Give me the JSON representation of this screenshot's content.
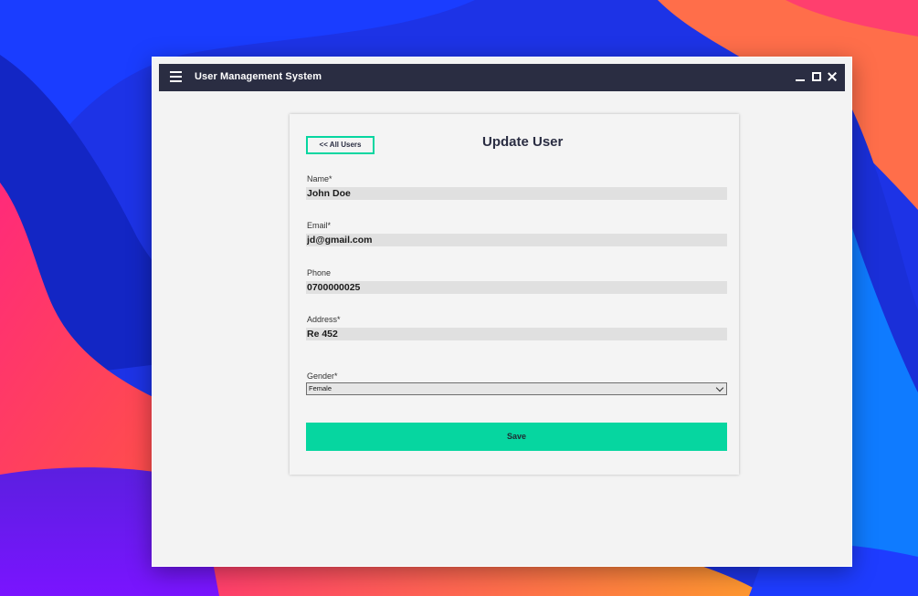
{
  "window": {
    "title": "User Management System"
  },
  "form": {
    "back_label": "<< All Users",
    "title": "Update User",
    "fields": {
      "name": {
        "label": "Name*",
        "value": "John Doe"
      },
      "email": {
        "label": "Email*",
        "value": "jd@gmail.com"
      },
      "phone": {
        "label": "Phone",
        "value": "0700000025"
      },
      "address": {
        "label": "Address*",
        "value": "Re 452"
      },
      "gender": {
        "label": "Gender*",
        "value": "Female"
      }
    },
    "save_label": "Save"
  },
  "colors": {
    "titlebar": "#2a2d42",
    "accent": "#06d6a0",
    "window_bg": "#f3f3f3",
    "input_bg": "#e0e0e0"
  },
  "icons": {
    "menu": "hamburger-icon",
    "minimize": "minimize-icon",
    "maximize": "maximize-icon",
    "close": "close-icon",
    "dropdown": "chevron-down-icon"
  }
}
